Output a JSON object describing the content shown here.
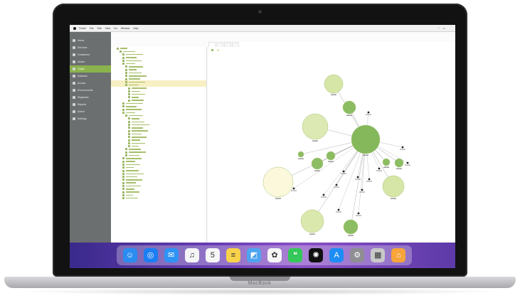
{
  "device": {
    "brand_label": "MacBook"
  },
  "menubar": {
    "items": [
      "Finder",
      "File",
      "Edit",
      "View",
      "Go",
      "Window",
      "Help"
    ],
    "status": [
      "",
      "",
      "",
      ""
    ]
  },
  "sidebar": {
    "items": [
      {
        "label": "Home"
      },
      {
        "label": "Services"
      },
      {
        "label": "Containers"
      },
      {
        "label": "Nodes"
      },
      {
        "label": "Graph"
      },
      {
        "label": "Datasets"
      },
      {
        "label": "Access"
      },
      {
        "label": "Environments"
      },
      {
        "label": "Registries"
      },
      {
        "label": "Reports"
      },
      {
        "label": "Admin"
      },
      {
        "label": "Settings"
      }
    ],
    "active_index": 4
  },
  "main": {
    "title": "",
    "breadcrumb": "",
    "tabs": [
      {
        "label": ""
      },
      {
        "label": ""
      },
      {
        "label": ""
      },
      {
        "label": ""
      }
    ],
    "legend": [
      {
        "label": "",
        "color": "#8bb34d"
      },
      {
        "label": "",
        "color": "#d8e6a8"
      }
    ]
  },
  "tree": {
    "rows": 50
  },
  "graph": {
    "nodes": [
      {
        "id": "hub",
        "size": "large",
        "color": "#84b85a"
      },
      {
        "id": "n1",
        "size": "medium",
        "color": "#d5e6a6"
      },
      {
        "id": "n2",
        "size": "large-pale",
        "color": "#dde9b3"
      },
      {
        "id": "n3",
        "size": "large-pale",
        "color": "#fbf8dc"
      },
      {
        "id": "n4",
        "size": "medium",
        "color": "#d5e6a6"
      },
      {
        "id": "n5",
        "size": "medium",
        "color": "#dbe8ad"
      },
      {
        "id": "n6",
        "size": "small",
        "color": "#8cbd62"
      },
      {
        "id": "n7",
        "size": "small",
        "color": "#8cbd62"
      },
      {
        "id": "n8",
        "size": "small",
        "color": "#8cbd62"
      },
      {
        "id": "n9",
        "size": "small",
        "color": "#8cbd62"
      },
      {
        "id": "n10",
        "size": "small",
        "color": "#8cbd62"
      },
      {
        "id": "n11",
        "size": "small",
        "color": "#8cbd62"
      },
      {
        "id": "n12",
        "size": "small",
        "color": "#8cbd62"
      }
    ]
  },
  "dock": {
    "apps": [
      {
        "icon": "finder-icon",
        "color": "#2a8cf0",
        "glyph": "☺"
      },
      {
        "icon": "safari-icon",
        "color": "#1c7ef2",
        "glyph": "◎"
      },
      {
        "icon": "mail-icon",
        "color": "#2f93f5",
        "glyph": "✉"
      },
      {
        "icon": "music-icon",
        "color": "#f5f5f7",
        "glyph": "♫"
      },
      {
        "icon": "calendar-icon",
        "color": "#f7f7f7",
        "glyph": "5"
      },
      {
        "icon": "notes-icon",
        "color": "#f8d24a",
        "glyph": "≡"
      },
      {
        "icon": "preview-icon",
        "color": "#4ea4f0",
        "glyph": "◩"
      },
      {
        "icon": "photos-icon",
        "color": "#f7f7f7",
        "glyph": "✿"
      },
      {
        "icon": "messages-icon",
        "color": "#34c759",
        "glyph": "❝"
      },
      {
        "icon": "openai-icon",
        "color": "#111111",
        "glyph": "✺"
      },
      {
        "icon": "app-store-icon",
        "color": "#1d8cf4",
        "glyph": "A"
      },
      {
        "icon": "system-settings-icon",
        "color": "#8e8e93",
        "glyph": "⚙"
      },
      {
        "icon": "archive-icon",
        "color": "#c9c9c9",
        "glyph": "▦"
      },
      {
        "icon": "home-icon",
        "color": "#f7a43a",
        "glyph": "⌂"
      }
    ]
  }
}
